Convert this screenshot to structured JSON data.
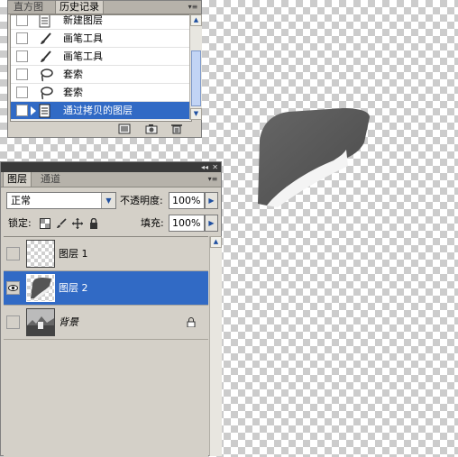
{
  "history_panel": {
    "tabs": [
      "直方图",
      "历史记录"
    ],
    "active_tab": "历史记录",
    "items": [
      {
        "label": "新建图层",
        "icon": "document-icon",
        "selected": false
      },
      {
        "label": "画笔工具",
        "icon": "brush-icon",
        "selected": false
      },
      {
        "label": "画笔工具",
        "icon": "brush-icon",
        "selected": false
      },
      {
        "label": "套索",
        "icon": "lasso-icon",
        "selected": false
      },
      {
        "label": "套索",
        "icon": "lasso-icon",
        "selected": false
      },
      {
        "label": "通过拷贝的图层",
        "icon": "document-icon",
        "selected": true
      }
    ],
    "footer_icons": [
      "new-document-from-state-icon",
      "camera-snapshot-icon",
      "trash-icon"
    ]
  },
  "layers_panel": {
    "tabs": [
      "图层",
      "通道"
    ],
    "active_tab": "图层",
    "blend_mode": "正常",
    "opacity_label": "不透明度:",
    "opacity_value": "100%",
    "lock_label": "锁定:",
    "lock_icons": [
      "lock-transparency-icon",
      "lock-paint-icon",
      "lock-move-icon",
      "lock-all-icon"
    ],
    "fill_label": "填充:",
    "fill_value": "100%",
    "layers": [
      {
        "name": "图层 1",
        "visible": false,
        "selected": false,
        "thumbnail": "transparent"
      },
      {
        "name": "图层 2",
        "visible": true,
        "selected": true,
        "thumbnail": "shape"
      },
      {
        "name": "背景",
        "visible": false,
        "selected": false,
        "thumbnail": "photo",
        "locked": true
      }
    ]
  },
  "colors": {
    "selection": "#316ac5",
    "panel": "#d4d0c8"
  }
}
